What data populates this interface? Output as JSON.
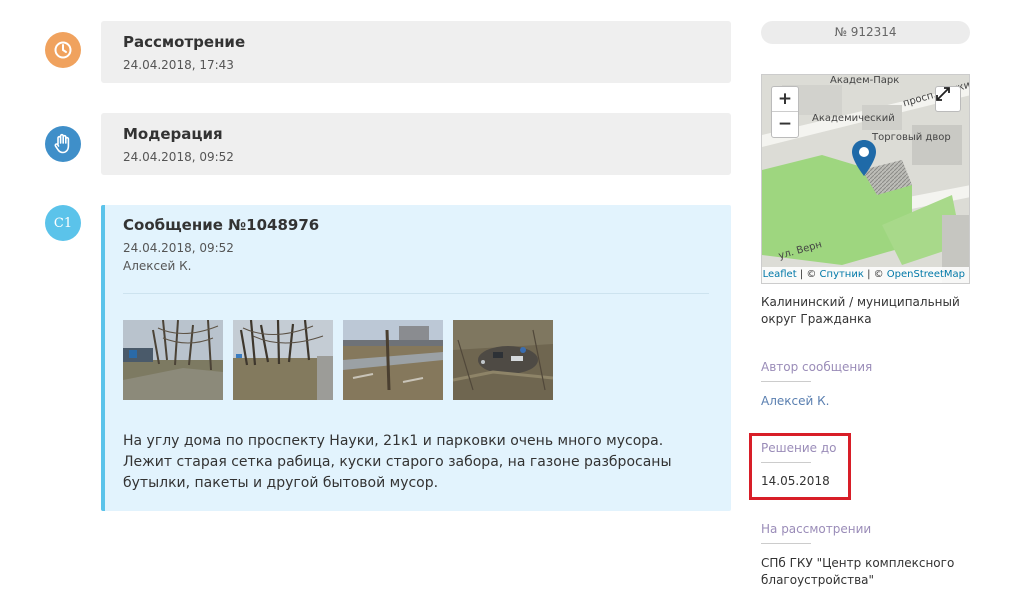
{
  "timeline": [
    {
      "title": "Рассмотрение",
      "date": "24.04.2018, 17:43",
      "icon": "clock-icon",
      "color": "#f0a25e"
    },
    {
      "title": "Модерация",
      "date": "24.04.2018, 09:52",
      "icon": "hand-icon",
      "color": "#3f8fc9"
    }
  ],
  "message": {
    "badge": "C1",
    "title": "Сообщение №1048976",
    "date": "24.04.2018, 09:52",
    "author": "Алексей К.",
    "text": "На углу дома по проспекту Науки, 21к1 и парковки очень много мусора. Лежит старая сетка рабица, куски старого забора, на газоне разбросаны бутылки, пакеты и другой бытовой мусор.",
    "accent_color": "#5bc3ea"
  },
  "sidebar": {
    "number": "№ 912314",
    "map": {
      "zoom_in": "+",
      "zoom_out": "−",
      "labels": [
        "Академ-Парк",
        "просп. Науки",
        "Академический",
        "Торговый двор",
        "ул. Верн"
      ],
      "attribution": {
        "leaflet": "Leaflet",
        "sep1": " | © ",
        "sputnik": "Спутник",
        "sep2": " | © ",
        "osm": "OpenStreetMap"
      }
    },
    "district": "Калининский / муниципальный округ Гражданка",
    "author_label": "Автор сообщения",
    "author_value": "Алексей К.",
    "deadline_label": "Решение до",
    "deadline_value": "14.05.2018",
    "review_label": "На рассмотрении",
    "review_value": "СПб ГКУ \"Центр комплексного благоустройства\"",
    "highlight_color": "#d81e28"
  }
}
